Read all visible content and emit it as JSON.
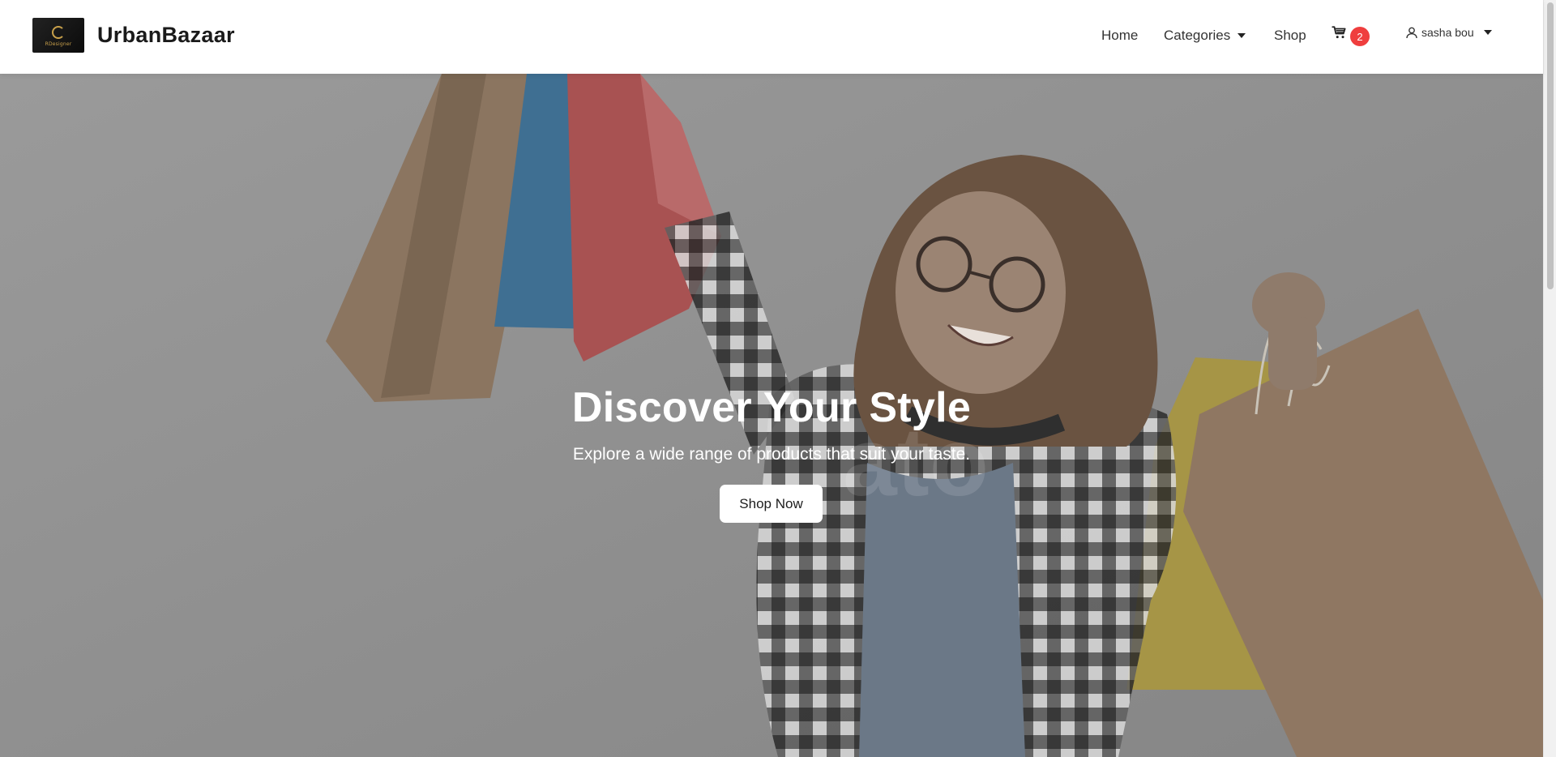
{
  "header": {
    "logo_text": "RDesigner",
    "brand": "UrbanBazaar",
    "nav": {
      "home": "Home",
      "categories": "Categories",
      "shop": "Shop"
    },
    "cart_count": "2",
    "user_name": "sasha bou"
  },
  "hero": {
    "title": "Discover Your Style",
    "subtitle": "Explore a wide range of products that suit your taste.",
    "cta_label": "Shop Now"
  },
  "colors": {
    "badge": "#ef3e3e",
    "hero_overlay": "#8f8f8f"
  }
}
